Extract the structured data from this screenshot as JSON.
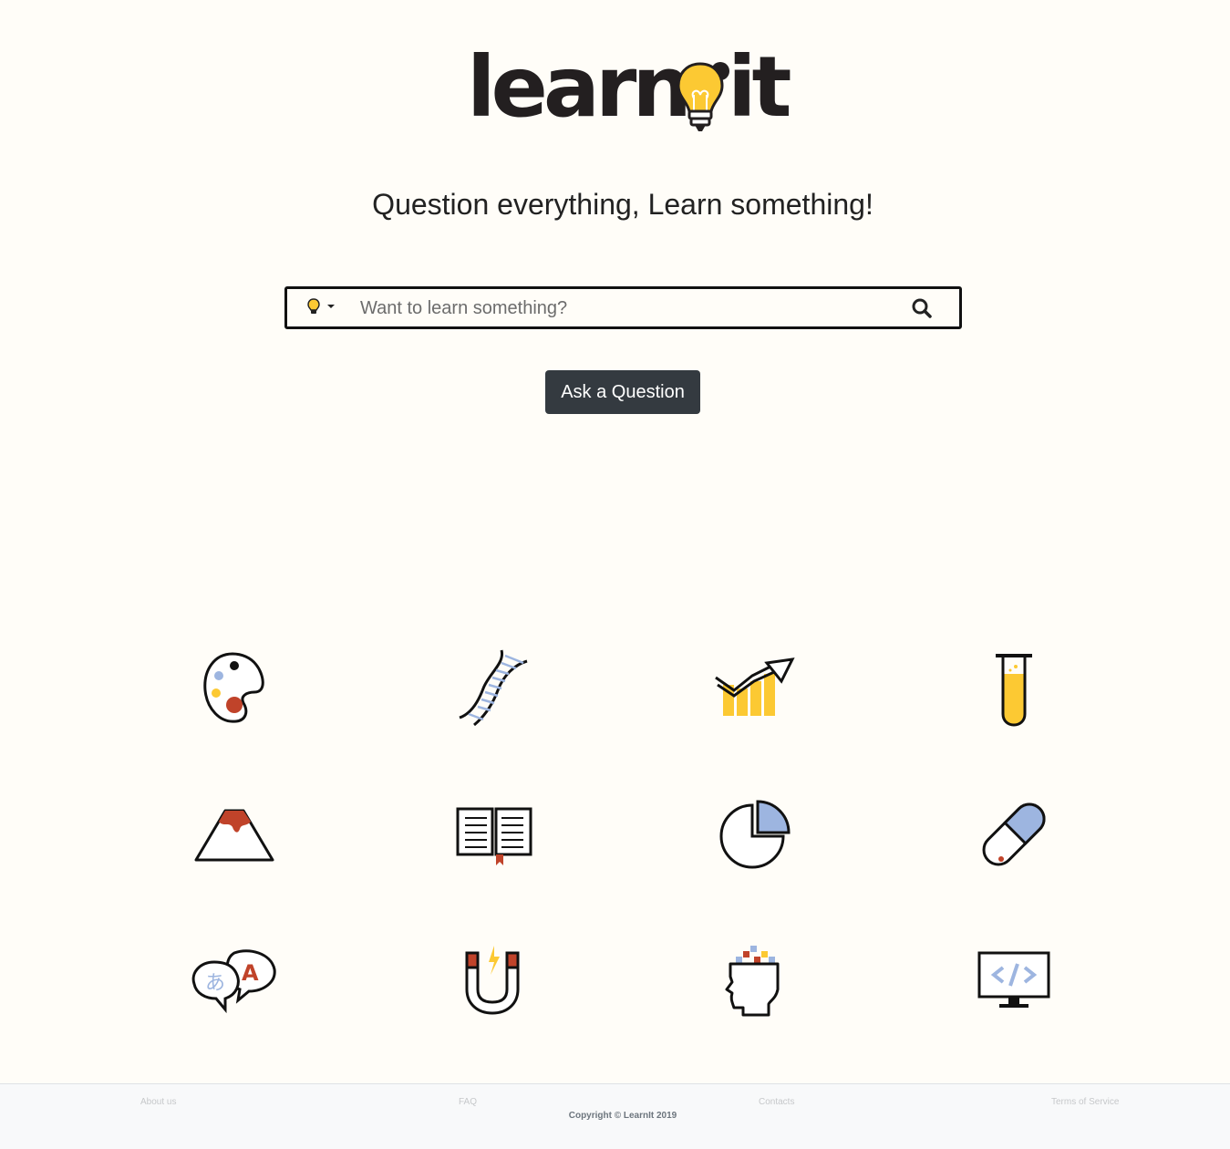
{
  "brand": {
    "logo_text_left": "learn",
    "logo_text_right": "it"
  },
  "tagline": "Question everything, Learn something!",
  "search": {
    "placeholder": "Want to learn something?",
    "dropdown_icon": "lightbulb-icon",
    "submit_icon": "search-icon"
  },
  "ask_button": {
    "label": "Ask a Question"
  },
  "categories": [
    {
      "icon": "art-palette-icon"
    },
    {
      "icon": "dna-icon"
    },
    {
      "icon": "growth-chart-icon"
    },
    {
      "icon": "test-tube-icon"
    },
    {
      "icon": "volcano-icon"
    },
    {
      "icon": "open-book-icon"
    },
    {
      "icon": "pie-chart-icon"
    },
    {
      "icon": "pill-icon"
    },
    {
      "icon": "language-bubbles-icon"
    },
    {
      "icon": "magnet-icon"
    },
    {
      "icon": "mind-head-icon"
    },
    {
      "icon": "code-monitor-icon"
    }
  ],
  "footer": {
    "links": [
      "About us",
      "FAQ",
      "Contacts",
      "Terms of Service"
    ],
    "copyright": "Copyright © LearnIt 2019"
  },
  "colors": {
    "background": "#fffdf8",
    "accent_yellow": "#fcc933",
    "accent_blue": "#9db5e0",
    "accent_red": "#c0432a",
    "button_dark": "#343a40"
  }
}
